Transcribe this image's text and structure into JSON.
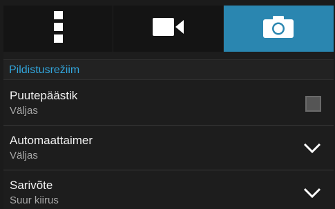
{
  "tabs": [
    {
      "name": "more-options",
      "icon": "more-vertical-icon",
      "active": false
    },
    {
      "name": "video-mode",
      "icon": "video-camera-icon",
      "active": false
    },
    {
      "name": "photo-mode",
      "icon": "camera-icon",
      "active": true
    }
  ],
  "section": {
    "title": "Pildistusrežiim"
  },
  "settings": [
    {
      "title": "Puutepäästik",
      "value": "Väljas",
      "control": "checkbox",
      "checked": false
    },
    {
      "title": "Automaattaimer",
      "value": "Väljas",
      "control": "dropdown"
    },
    {
      "title": "Sarivõte",
      "value": "Suur kiirus",
      "control": "dropdown"
    }
  ],
  "colors": {
    "accent": "#2a86b0",
    "section_text": "#32a6dd"
  }
}
